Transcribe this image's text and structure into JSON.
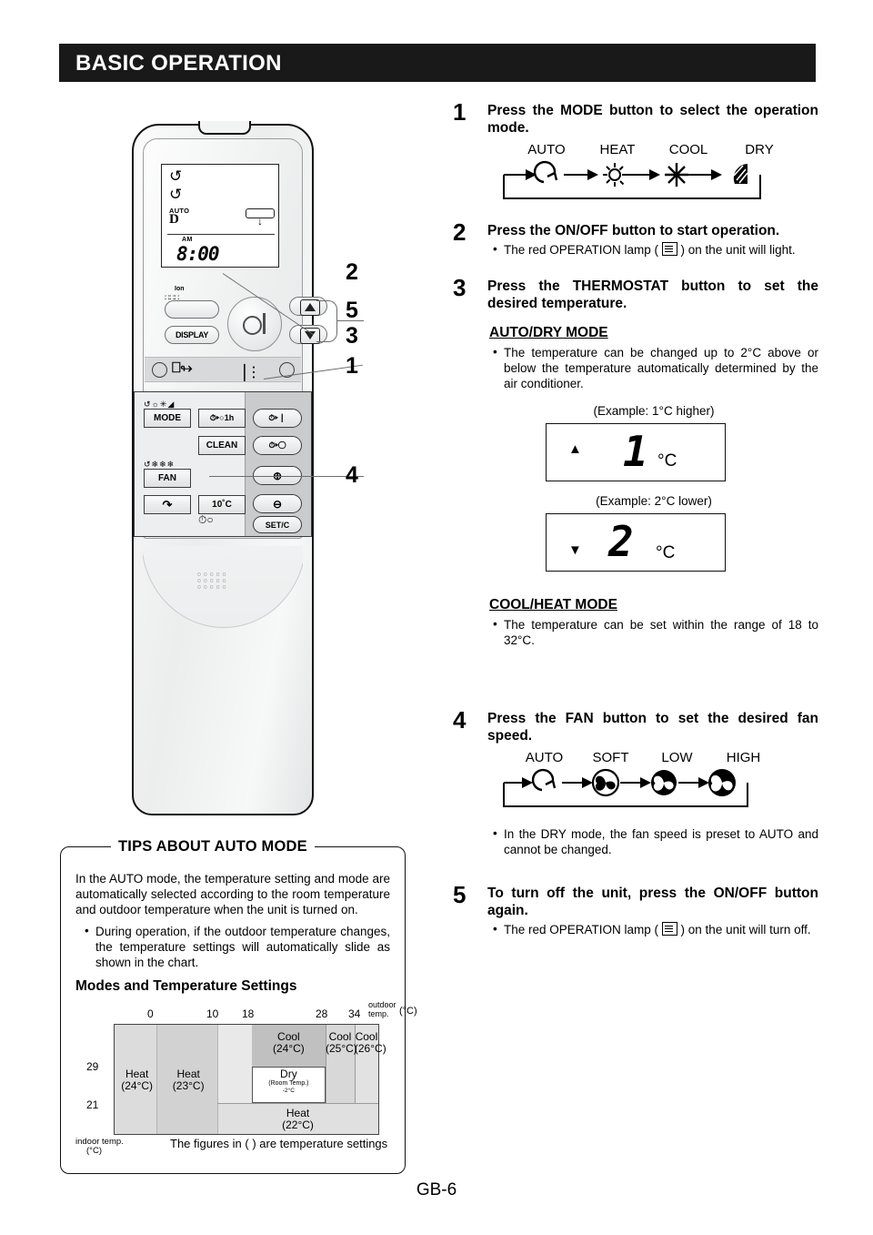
{
  "header": {
    "title": "BASIC OPERATION"
  },
  "footer": {
    "page": "GB-6"
  },
  "remote": {
    "lcd": {
      "swing_icon_1": "swing-icon",
      "swing_icon_2": "swing-icon",
      "auto_label": "AUTO",
      "mode_symbol": "D",
      "am_label": "AM",
      "clock": "8:00"
    },
    "buttons": {
      "ion": "Ion",
      "display": "DISPLAY",
      "mode": "MODE",
      "timer_1h": "1h",
      "clean": "CLEAN",
      "fan": "FAN",
      "ten_degree": "10˚C",
      "set_c": "SET/C",
      "plus": "+",
      "minus": "−",
      "timer_on": "timer-on",
      "timer_off": "timer-off"
    },
    "callouts": [
      "1",
      "2",
      "3",
      "4",
      "5"
    ]
  },
  "steps": [
    {
      "num": "1",
      "heading": "Press the MODE button to select the operation mode.",
      "flow_labels": [
        "AUTO",
        "HEAT",
        "COOL",
        "DRY"
      ],
      "flow_icons": [
        "auto-swirl-icon",
        "sun-icon",
        "snowflake-icon",
        "dry-drop-icon"
      ]
    },
    {
      "num": "2",
      "heading": "Press the ON/OFF button to start operation.",
      "bullet_pre": "The red OPERATION lamp ( ",
      "bullet_post": " ) on the unit will light.",
      "lamp_icon": "operation-lamp-icon"
    },
    {
      "num": "3",
      "heading": "Press the THERMOSTAT button to set the desired temperature."
    },
    {
      "num": "4",
      "heading": "Press the FAN button to set the desired fan speed.",
      "flow_labels": [
        "AUTO",
        "SOFT",
        "LOW",
        "HIGH"
      ],
      "flow_icons": [
        "auto-swirl-icon",
        "fan-soft-icon",
        "fan-low-icon",
        "fan-high-icon"
      ],
      "bullet": "In the DRY mode, the fan speed is preset to AUTO and cannot be changed."
    },
    {
      "num": "5",
      "heading": "To turn off the unit, press the ON/OFF button again.",
      "bullet_pre": "The red OPERATION lamp ( ",
      "bullet_post": " ) on the unit will turn off.",
      "lamp_icon": "operation-lamp-icon"
    }
  ],
  "auto_dry": {
    "title": "AUTO/DRY MODE",
    "body": "The temperature can be changed up to 2°C above or below the temperature automatically determined by the air conditioner.",
    "example_high_label": "(Example: 1°C higher)",
    "example_high_value": "1",
    "example_high_unit": "°C",
    "example_high_arrow": "▲",
    "example_low_label": "(Example: 2°C lower)",
    "example_low_value": "2",
    "example_low_unit": "°C",
    "example_low_arrow": "▼"
  },
  "cool_heat": {
    "title": "COOL/HEAT MODE",
    "body": "The temperature can be set within the range of 18 to 32°C."
  },
  "tips": {
    "title": "TIPS ABOUT AUTO MODE",
    "paragraph": "In the AUTO mode, the temperature setting and mode are automatically selected according to the room temperature and outdoor temperature when the unit is turned on.",
    "bullet": "During operation, if the outdoor temperature changes, the temperature settings will automatically slide as shown in the chart.",
    "chart_heading": "Modes and Temperature Settings",
    "note": "The figures in (  ) are temperature settings"
  },
  "chart_data": {
    "type": "heatmap",
    "title": "Modes and Temperature Settings",
    "xlabel": "outdoor temp. (°C)",
    "ylabel": "indoor temp. (°C)",
    "xlabel_line1": "outdoor",
    "xlabel_line2": "temp.",
    "xlabel_unit": "(°C)",
    "ylabel_line1": "indoor temp.",
    "ylabel_line2": "(°C)",
    "xticks": [
      "0",
      "10",
      "18",
      "28",
      "34"
    ],
    "xtick_pos_pct": [
      16,
      39,
      52,
      80,
      91
    ],
    "yticks": [
      "29",
      "21"
    ],
    "ytick_pos_pct": [
      38,
      72
    ],
    "xlim": [
      -8,
      40
    ],
    "ylim": [
      14,
      36
    ],
    "grid": false,
    "legend": "none",
    "note": "The figures in (  ) are temperature settings",
    "regions": [
      {
        "label": "Heat",
        "setting": "(24°C)",
        "x_start_pct": 0,
        "x_end_pct": 16,
        "y_start_pct": 0,
        "y_end_pct": 100,
        "fill": "#dcdcdc"
      },
      {
        "label": "Heat",
        "setting": "(23°C)",
        "x_start_pct": 16,
        "x_end_pct": 39,
        "y_start_pct": 0,
        "y_end_pct": 100,
        "fill": "#d2d2d2"
      },
      {
        "label": "",
        "setting": "",
        "x_start_pct": 39,
        "x_end_pct": 52,
        "y_start_pct": 0,
        "y_end_pct": 100,
        "fill": "#e9e9e9"
      },
      {
        "label": "Cool",
        "setting": "(24°C)",
        "x_start_pct": 52,
        "x_end_pct": 80,
        "y_start_pct": 0,
        "y_end_pct": 72,
        "fill": "#c0c0c0"
      },
      {
        "label": "Cool",
        "setting": "(25°C)",
        "x_start_pct": 80,
        "x_end_pct": 91,
        "y_start_pct": 0,
        "y_end_pct": 72,
        "fill": "#d8d8d8"
      },
      {
        "label": "Cool",
        "setting": "(26°C)",
        "x_start_pct": 91,
        "x_end_pct": 100,
        "y_start_pct": 0,
        "y_end_pct": 72,
        "fill": "#e2e2e2"
      },
      {
        "label": "Heat",
        "setting": "(22°C)",
        "x_start_pct": 39,
        "x_end_pct": 100,
        "y_start_pct": 72,
        "y_end_pct": 100,
        "fill": "#e0e0e0"
      }
    ],
    "dry_box": {
      "label": "Dry",
      "paren_open": "(",
      "sub_line1": "Room Temp.",
      "sub_line2": "-2°C",
      "paren_close": ")",
      "x_start_pct": 52,
      "x_end_pct": 80,
      "y_start_pct": 38,
      "y_end_pct": 72,
      "fill": "#ffffff"
    }
  }
}
